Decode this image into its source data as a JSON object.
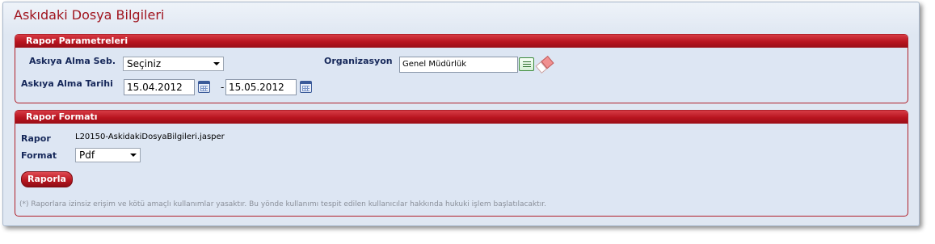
{
  "page": {
    "title": "Askıdaki Dosya Bilgileri"
  },
  "params_panel": {
    "header": "Rapor Parametreleri",
    "suspend_type": {
      "label": "Askıya Alma Seb.",
      "selected": "Seçiniz"
    },
    "organization": {
      "label": "Organizasyon",
      "value": "Genel Müdürlük"
    },
    "suspend_date": {
      "label": "Askıya Alma Tarihi",
      "from": "15.04.2012",
      "separator": "-",
      "to": "15.05.2012"
    }
  },
  "format_panel": {
    "header": "Rapor Formatı",
    "report": {
      "label": "Rapor",
      "value": "L20150-AskidakiDosyaBilgileri.jasper"
    },
    "format": {
      "label": "Format",
      "selected": "Pdf"
    },
    "submit_label": "Raporla",
    "disclaimer": "(*) Raporlara izinsiz erişim ve kötü amaçlı kullanımlar yasaktır. Bu yönde kullanımı tespit edilen kullanıcılar hakkında hukuki işlem başlatılacaktır."
  },
  "icons": {
    "calendar": "calendar-icon",
    "list": "list-lookup-icon",
    "eraser": "eraser-icon",
    "dropdown": "chevron-down-icon"
  },
  "colors": {
    "title": "#a0141e",
    "panel_header": "#b8141f",
    "label": "#16285a",
    "panel_bg": "#dde6f3"
  }
}
